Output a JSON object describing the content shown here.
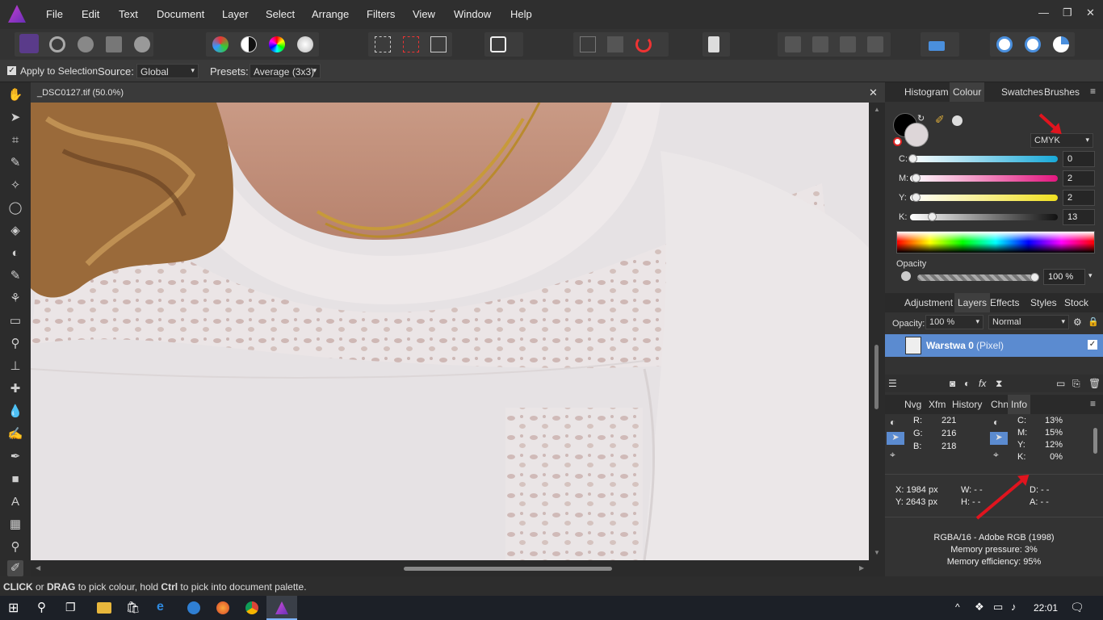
{
  "menu": [
    "File",
    "Edit",
    "Text",
    "Document",
    "Layer",
    "Select",
    "Arrange",
    "Filters",
    "View",
    "Window",
    "Help"
  ],
  "context": {
    "apply_label": "Apply to Selection",
    "source_label": "Source:",
    "source_value": "Global",
    "presets_label": "Presets:",
    "presets_value": "Average (3x3)"
  },
  "document": {
    "tab_title": "_DSC0127.tif (50.0%)"
  },
  "colour_panel": {
    "tabs": [
      "Histogram",
      "Colour",
      "Swatches",
      "Brushes"
    ],
    "mode": "CMYK",
    "channels": [
      {
        "label": "C:",
        "value": "0",
        "fraction": 0.0
      },
      {
        "label": "M:",
        "value": "2",
        "fraction": 0.02
      },
      {
        "label": "Y:",
        "value": "2",
        "fraction": 0.02
      },
      {
        "label": "K:",
        "value": "13",
        "fraction": 0.13
      }
    ],
    "opacity_label": "Opacity",
    "opacity_value": "100 %"
  },
  "layers_panel": {
    "tabs": [
      "Adjustment",
      "Layers",
      "Effects",
      "Styles",
      "Stock"
    ],
    "opacity_label": "Opacity:",
    "opacity_value": "100 %",
    "blend_mode": "Normal",
    "layer_name": "Warstwa 0",
    "layer_type": "(Pixel)"
  },
  "info_panel": {
    "tabs": [
      "Nvg",
      "Xfm",
      "History",
      "Chn",
      "Info"
    ],
    "rgb": [
      {
        "label": "R:",
        "value": "221"
      },
      {
        "label": "G:",
        "value": "216"
      },
      {
        "label": "B:",
        "value": "218"
      }
    ],
    "cmyk": [
      {
        "label": "C:",
        "value": "13%"
      },
      {
        "label": "M:",
        "value": "15%"
      },
      {
        "label": "Y:",
        "value": "12%"
      },
      {
        "label": "K:",
        "value": "0%"
      }
    ],
    "x": "X: 1984 px",
    "y": "Y: 2643 px",
    "w": "W: - -",
    "h": "H: - -",
    "d": "D: - -",
    "a": "A: - -",
    "format": "RGBA/16 - Adobe RGB (1998)",
    "memory_pressure": "Memory pressure: 3%",
    "memory_efficiency": "Memory efficiency: 95%"
  },
  "status": {
    "click": "CLICK",
    "or": " or ",
    "drag": "DRAG",
    "mid": " to pick colour, hold ",
    "ctrl": "Ctrl",
    "end": " to pick into document palette."
  },
  "taskbar": {
    "time": "22:01"
  },
  "colors": {
    "accent_selection": "#5b8bd0",
    "annotation_arrow": "#e0141e"
  }
}
